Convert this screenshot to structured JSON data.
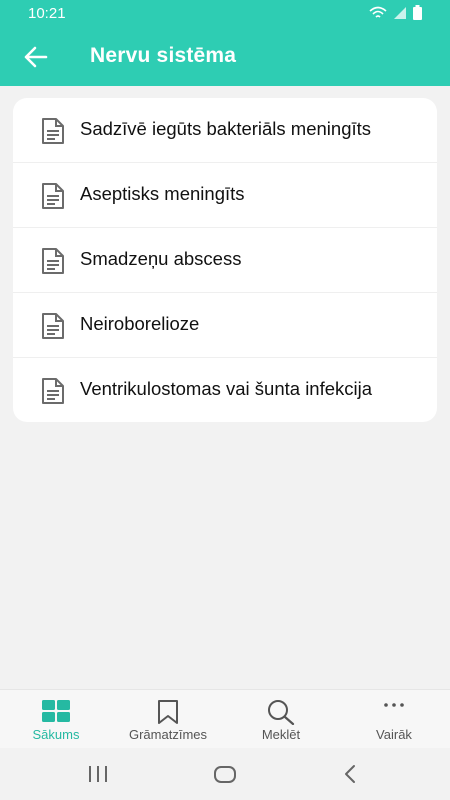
{
  "status": {
    "time": "10:21"
  },
  "app_bar": {
    "title": "Nervu sistēma"
  },
  "list": {
    "items": [
      {
        "label": "Sadzīvē iegūts bakteriāls meningīts"
      },
      {
        "label": "Aseptisks meningīts"
      },
      {
        "label": "Smadzeņu abscess"
      },
      {
        "label": "Neiroborelioze"
      },
      {
        "label": "Ventrikulostomas vai šunta infekcija"
      }
    ]
  },
  "bottom_nav": {
    "items": [
      {
        "label": "Sākums",
        "icon": "grid-icon",
        "active": true
      },
      {
        "label": "Grāmatzīmes",
        "icon": "bookmark-icon",
        "active": false
      },
      {
        "label": "Meklēt",
        "icon": "search-icon",
        "active": false
      },
      {
        "label": "Vairāk",
        "icon": "more-icon",
        "active": false
      }
    ]
  },
  "colors": {
    "accent": "#2ecdb3",
    "active_tab": "#25b9a2",
    "background": "#f2f2f2"
  }
}
